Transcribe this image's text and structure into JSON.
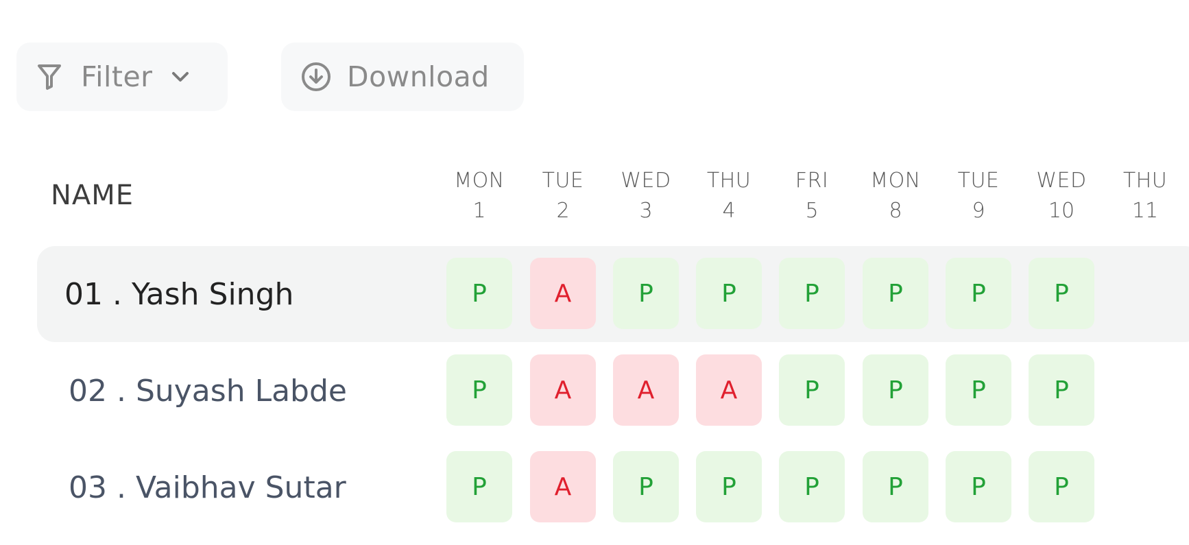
{
  "toolbar": {
    "filter_label": "Filter",
    "download_label": "Download",
    "filter_icon": "filter-funnel-icon",
    "chevron_icon": "chevron-down-icon",
    "download_icon": "download-circle-icon"
  },
  "table": {
    "name_header": "NAME",
    "days": [
      {
        "name": "MON",
        "date": "1"
      },
      {
        "name": "TUE",
        "date": "2"
      },
      {
        "name": "WED",
        "date": "3"
      },
      {
        "name": "THU",
        "date": "4"
      },
      {
        "name": "FRI",
        "date": "5"
      },
      {
        "name": "MON",
        "date": "8"
      },
      {
        "name": "TUE",
        "date": "9"
      },
      {
        "name": "WED",
        "date": "10"
      },
      {
        "name": "THU",
        "date": "11"
      }
    ],
    "rows": [
      {
        "name": "01 . Yash Singh",
        "active": true,
        "marks": [
          "P",
          "A",
          "P",
          "P",
          "P",
          "P",
          "P",
          "P"
        ]
      },
      {
        "name": "02 . Suyash Labde",
        "active": false,
        "marks": [
          "P",
          "A",
          "A",
          "A",
          "P",
          "P",
          "P",
          "P"
        ]
      },
      {
        "name": "03 . Vaibhav Sutar",
        "active": false,
        "marks": [
          "P",
          "A",
          "P",
          "P",
          "P",
          "P",
          "P",
          "P"
        ]
      }
    ]
  },
  "colors": {
    "present_bg": "#e8f8e4",
    "present_text": "#22a137",
    "absent_bg": "#fddde0",
    "absent_text": "#e0202e",
    "active_row_bg": "#f3f4f4"
  }
}
